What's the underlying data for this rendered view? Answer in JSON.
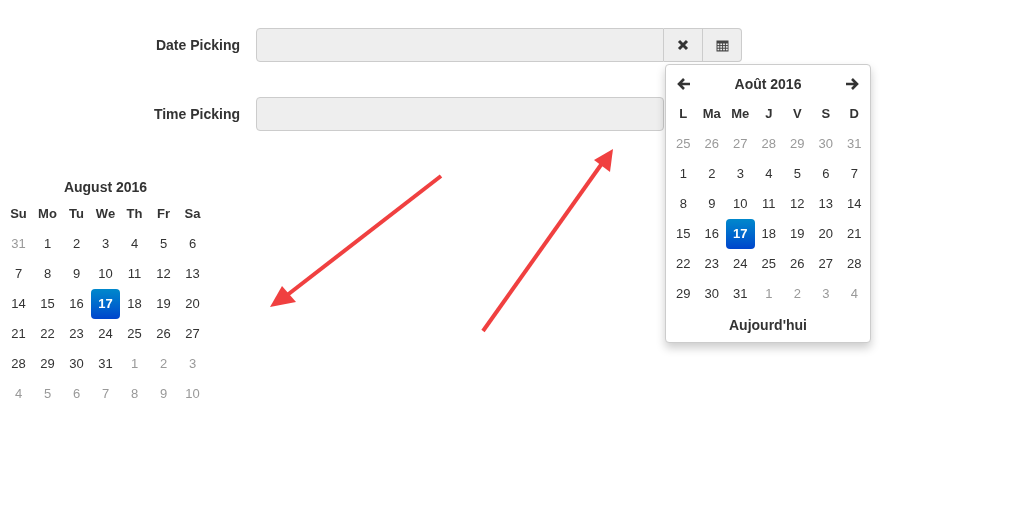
{
  "fields": [
    {
      "label": "Date Picking",
      "buttons": [
        {
          "kind": "clear"
        },
        {
          "kind": "calendar"
        }
      ]
    },
    {
      "label": "Time Picking"
    }
  ],
  "popup": {
    "title": "Août 2016",
    "weekdays": [
      "L",
      "Ma",
      "Me",
      "J",
      "V",
      "S",
      "D"
    ],
    "weeks": [
      [
        {
          "label": "25",
          "muted": true,
          "selected": false
        },
        {
          "label": "26",
          "muted": true,
          "selected": false
        },
        {
          "label": "27",
          "muted": true,
          "selected": false
        },
        {
          "label": "28",
          "muted": true,
          "selected": false
        },
        {
          "label": "29",
          "muted": true,
          "selected": false
        },
        {
          "label": "30",
          "muted": true,
          "selected": false
        },
        {
          "label": "31",
          "muted": true,
          "selected": false
        }
      ],
      [
        {
          "label": "1",
          "muted": false,
          "selected": false
        },
        {
          "label": "2",
          "muted": false,
          "selected": false
        },
        {
          "label": "3",
          "muted": false,
          "selected": false
        },
        {
          "label": "4",
          "muted": false,
          "selected": false
        },
        {
          "label": "5",
          "muted": false,
          "selected": false
        },
        {
          "label": "6",
          "muted": false,
          "selected": false
        },
        {
          "label": "7",
          "muted": false,
          "selected": false
        }
      ],
      [
        {
          "label": "8",
          "muted": false,
          "selected": false
        },
        {
          "label": "9",
          "muted": false,
          "selected": false
        },
        {
          "label": "10",
          "muted": false,
          "selected": false
        },
        {
          "label": "11",
          "muted": false,
          "selected": false
        },
        {
          "label": "12",
          "muted": false,
          "selected": false
        },
        {
          "label": "13",
          "muted": false,
          "selected": false
        },
        {
          "label": "14",
          "muted": false,
          "selected": false
        }
      ],
      [
        {
          "label": "15",
          "muted": false,
          "selected": false
        },
        {
          "label": "16",
          "muted": false,
          "selected": false
        },
        {
          "label": "17",
          "selected": true
        },
        {
          "label": "18",
          "muted": false,
          "selected": false
        },
        {
          "label": "19",
          "muted": false,
          "selected": false
        },
        {
          "label": "20",
          "muted": false,
          "selected": false
        },
        {
          "label": "21",
          "muted": false,
          "selected": false
        }
      ],
      [
        {
          "label": "22",
          "muted": false,
          "selected": false
        },
        {
          "label": "23",
          "muted": false,
          "selected": false
        },
        {
          "label": "24",
          "muted": false,
          "selected": false
        },
        {
          "label": "25",
          "muted": false,
          "selected": false
        },
        {
          "label": "26",
          "muted": false,
          "selected": false
        },
        {
          "label": "27",
          "muted": false,
          "selected": false
        },
        {
          "label": "28",
          "muted": false,
          "selected": false
        }
      ],
      [
        {
          "label": "29",
          "muted": false,
          "selected": false
        },
        {
          "label": "30",
          "muted": false,
          "selected": false
        },
        {
          "label": "31",
          "muted": false,
          "selected": false
        },
        {
          "label": "1",
          "muted": true,
          "selected": false
        },
        {
          "label": "2",
          "muted": true,
          "selected": false
        },
        {
          "label": "3",
          "muted": true,
          "selected": false
        },
        {
          "label": "4",
          "muted": true,
          "selected": false
        }
      ]
    ],
    "today": "Aujourd'hui"
  },
  "inline_calendar": {
    "title": "August 2016",
    "weekdays": [
      "Su",
      "Mo",
      "Tu",
      "We",
      "Th",
      "Fr",
      "Sa"
    ],
    "weeks": [
      [
        {
          "label": "31",
          "muted": true,
          "selected": false
        },
        {
          "label": "1",
          "muted": false,
          "selected": false
        },
        {
          "label": "2",
          "muted": false,
          "selected": false
        },
        {
          "label": "3",
          "muted": false,
          "selected": false
        },
        {
          "label": "4",
          "muted": false,
          "selected": false
        },
        {
          "label": "5",
          "muted": false,
          "selected": false
        },
        {
          "label": "6",
          "muted": false,
          "selected": false
        }
      ],
      [
        {
          "label": "7",
          "muted": false,
          "selected": false
        },
        {
          "label": "8",
          "muted": false,
          "selected": false
        },
        {
          "label": "9",
          "muted": false,
          "selected": false
        },
        {
          "label": "10",
          "muted": false,
          "selected": false
        },
        {
          "label": "11",
          "muted": false,
          "selected": false
        },
        {
          "label": "12",
          "muted": false,
          "selected": false
        },
        {
          "label": "13",
          "muted": false,
          "selected": false
        }
      ],
      [
        {
          "label": "14",
          "muted": false,
          "selected": false
        },
        {
          "label": "15",
          "muted": false,
          "selected": false
        },
        {
          "label": "16",
          "muted": false,
          "selected": false
        },
        {
          "label": "17",
          "selected": true
        },
        {
          "label": "18",
          "muted": false,
          "selected": false
        },
        {
          "label": "19",
          "muted": false,
          "selected": false
        },
        {
          "label": "20",
          "muted": false,
          "selected": false
        }
      ],
      [
        {
          "label": "21",
          "muted": false,
          "selected": false
        },
        {
          "label": "22",
          "muted": false,
          "selected": false
        },
        {
          "label": "23",
          "muted": false,
          "selected": false
        },
        {
          "label": "24",
          "muted": false,
          "selected": false
        },
        {
          "label": "25",
          "muted": false,
          "selected": false
        },
        {
          "label": "26",
          "muted": false,
          "selected": false
        },
        {
          "label": "27",
          "muted": false,
          "selected": false
        }
      ],
      [
        {
          "label": "28",
          "muted": false,
          "selected": false
        },
        {
          "label": "29",
          "muted": false,
          "selected": false
        },
        {
          "label": "30",
          "muted": false,
          "selected": false
        },
        {
          "label": "31",
          "muted": false,
          "selected": false
        },
        {
          "label": "1",
          "muted": true,
          "selected": false
        },
        {
          "label": "2",
          "muted": true,
          "selected": false
        },
        {
          "label": "3",
          "muted": true,
          "selected": false
        }
      ],
      [
        {
          "label": "4",
          "muted": true,
          "selected": false
        },
        {
          "label": "5",
          "muted": true,
          "selected": false
        },
        {
          "label": "6",
          "muted": true,
          "selected": false
        },
        {
          "label": "7",
          "muted": true,
          "selected": false
        },
        {
          "label": "8",
          "muted": true,
          "selected": false
        },
        {
          "label": "9",
          "muted": true,
          "selected": false
        },
        {
          "label": "10",
          "muted": true,
          "selected": false
        }
      ]
    ]
  }
}
